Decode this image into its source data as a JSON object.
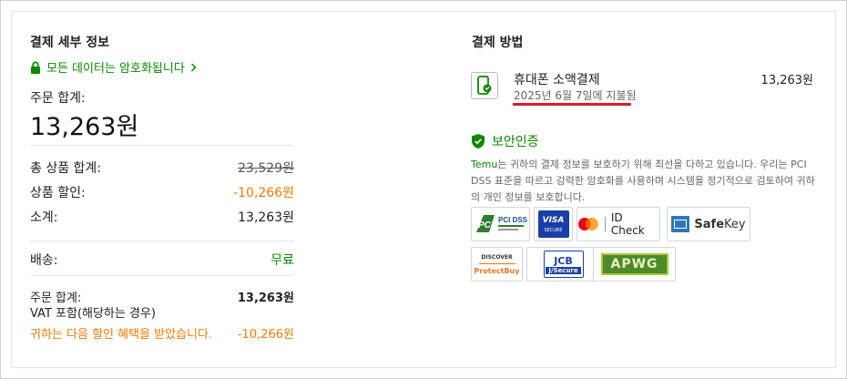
{
  "details": {
    "title": "결제 세부 정보",
    "encrypted_link": "모든 데이터는 암호화됩니다",
    "order_total_label": "주문 합계:",
    "order_total_big": "13,263원",
    "rows": [
      {
        "label": "총 상품 합계:",
        "value": "23,529원"
      },
      {
        "label": "상품 할인:",
        "value": "-10,266원"
      },
      {
        "label": "소계:",
        "value": "13,263원"
      }
    ],
    "shipping_label": "배송:",
    "shipping_value": "무료",
    "final_total_label": "주문 합계:",
    "final_total_value": "13,263원",
    "vat_note": "VAT 포함(해당하는 경우)",
    "discount_note": "귀하는 다음 할인 혜택을 받았습니다.",
    "discount_note_value": "-10,266원"
  },
  "payment": {
    "title": "결제 방법",
    "method_name": "휴대폰 소액결제",
    "method_sub": "2025년 6월 7일에 지불됨",
    "amount": "13,263원"
  },
  "security": {
    "title": "보안인증",
    "brand": "Temu",
    "text": "는 귀하의 결제 정보를 보호하기 위해 최선을 다하고 있습니다. 우리는 PCI DSS 표준을 따르고 강력한 암호화를 사용하며 시스템을 정기적으로 검토하여 귀하의 개인 정보를 보호합니다.",
    "badges": {
      "pci": "PCI DSS",
      "visa_top": "VISA",
      "visa_bottom": "SECURE",
      "idcheck": "ID Check",
      "safekey_a": "Safe",
      "safekey_b": "Key",
      "discover": "DISCOVER",
      "protectbuy": "ProtectBuy",
      "jcb_top": "JCB",
      "jcb_bottom": "J/Secure",
      "apwg": "APWG"
    }
  },
  "colors": {
    "green": "#0a8800",
    "orange": "#fb7701",
    "red": "#d91a2a"
  }
}
